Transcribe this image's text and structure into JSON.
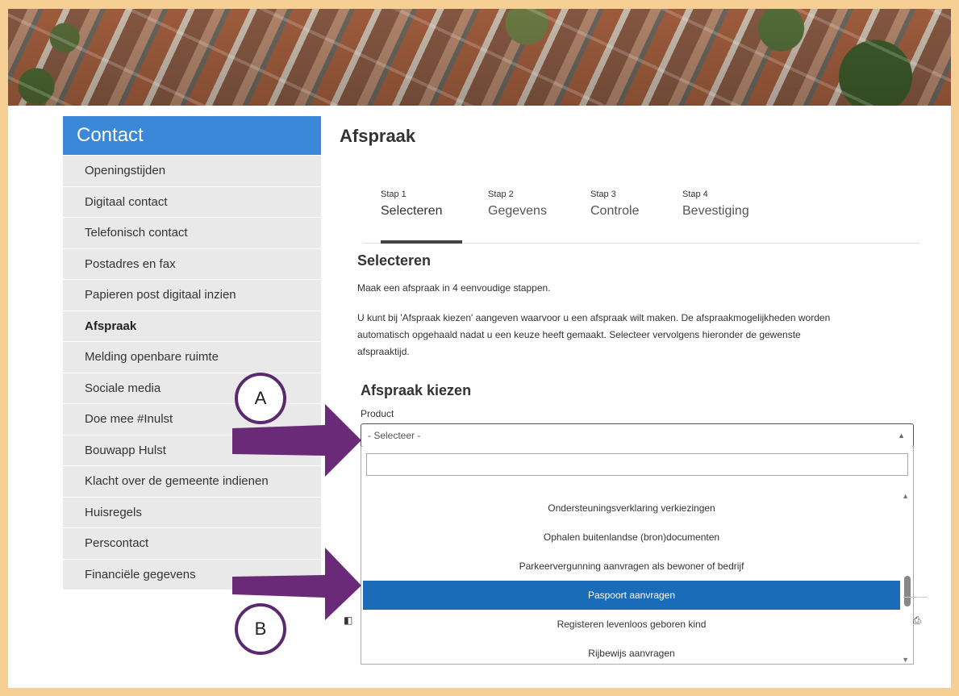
{
  "sidebar": {
    "title": "Contact",
    "items": [
      {
        "label": "Openingstijden"
      },
      {
        "label": "Digitaal contact"
      },
      {
        "label": "Telefonisch contact"
      },
      {
        "label": "Postadres en fax"
      },
      {
        "label": "Papieren post digitaal inzien"
      },
      {
        "label": "Afspraak"
      },
      {
        "label": "Melding openbare ruimte"
      },
      {
        "label": "Sociale media"
      },
      {
        "label": "Doe mee #Inulst"
      },
      {
        "label": "Bouwapp Hulst"
      },
      {
        "label": "Klacht over de gemeente indienen"
      },
      {
        "label": "Huisregels"
      },
      {
        "label": "Perscontact"
      },
      {
        "label": "Financiële gegevens"
      }
    ]
  },
  "main": {
    "title": "Afspraak",
    "steps": [
      {
        "small": "Stap 1",
        "label": "Selecteren"
      },
      {
        "small": "Stap 2",
        "label": "Gegevens"
      },
      {
        "small": "Stap 3",
        "label": "Controle"
      },
      {
        "small": "Stap 4",
        "label": "Bevestiging"
      }
    ],
    "section_title": "Selecteren",
    "intro": "Maak een afspraak in 4 eenvoudige stappen.",
    "description_line1": "U kunt bij 'Afspraak kiezen' aangeven waarvoor u een afspraak wilt maken. De afspraakmogelijkheden worden",
    "description_line2": "automatisch opgehaald nadat u een keuze heeft gemaakt. Selecteer vervolgens hieronder de gewenste",
    "description_line3": "afspraaktijd.",
    "choose_title": "Afspraak kiezen",
    "product_label": "Product",
    "select_value": "- Selecteer -",
    "options": [
      {
        "label": "Ondersteuningsverklaring verkiezingen"
      },
      {
        "label": "Ophalen buitenlandse (bron)documenten"
      },
      {
        "label": "Parkeervergunning aanvragen als bewoner of bedrijf"
      },
      {
        "label": "Paspoort aanvragen"
      },
      {
        "label": "Registeren levenloos geboren kind"
      },
      {
        "label": "Rijbewijs aanvragen"
      }
    ],
    "selected_option": "Paspoort aanvragen"
  },
  "annotations": {
    "a": "A",
    "b": "B",
    "arrow_color": "#6a2a78"
  }
}
